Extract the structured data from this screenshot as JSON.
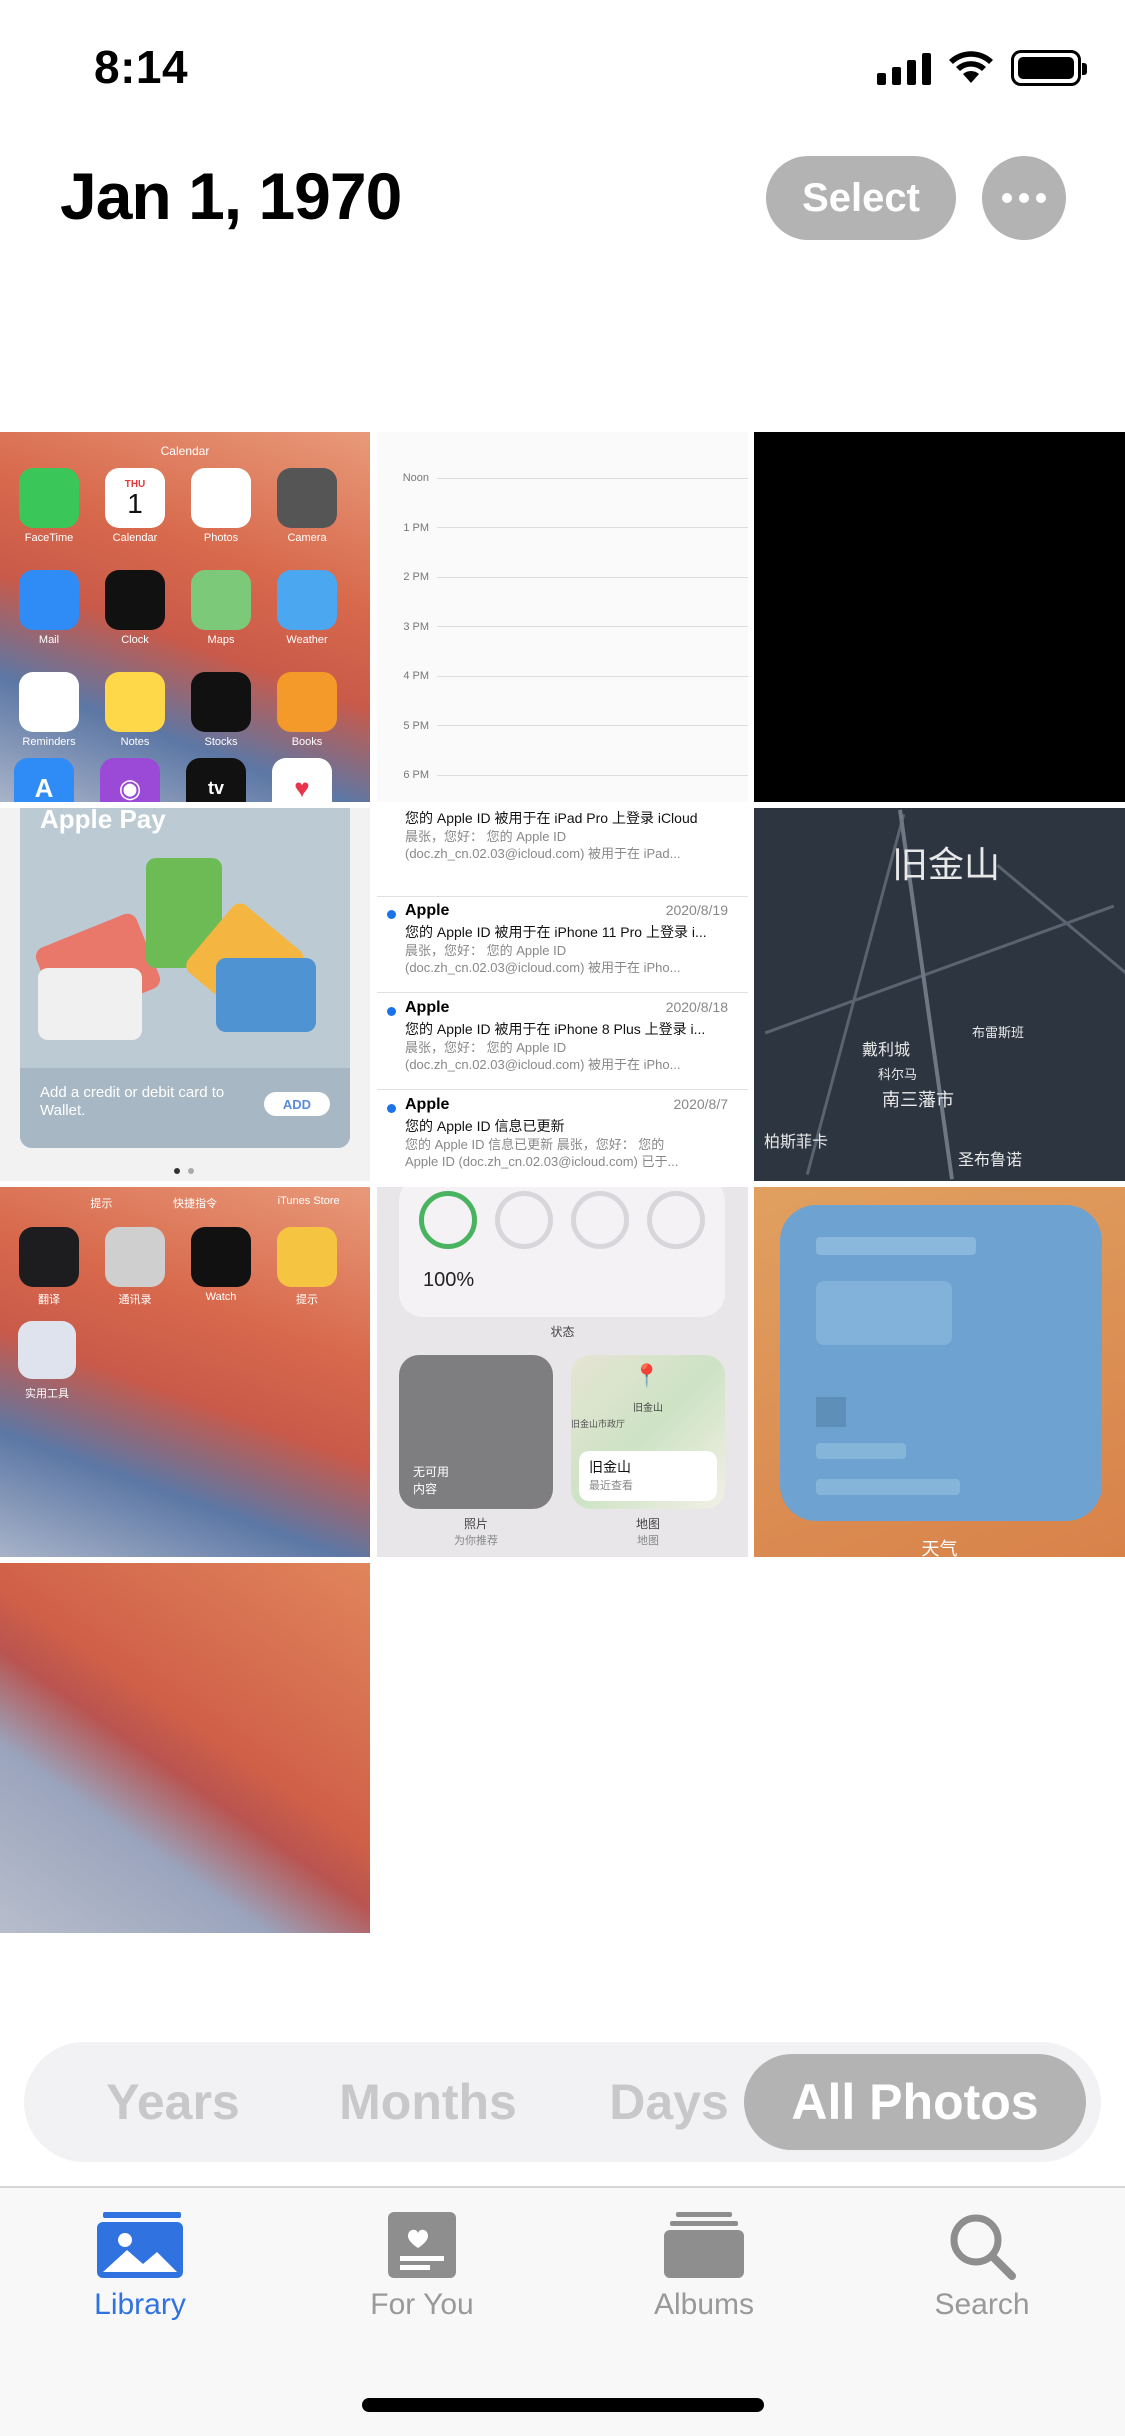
{
  "status_bar": {
    "time": "8:14"
  },
  "header": {
    "title": "Jan 1, 1970",
    "select_label": "Select"
  },
  "grid": {
    "home_screen": {
      "top_label": "Calendar",
      "calendar_day": "THU",
      "calendar_date": "1",
      "apps": [
        {
          "label": "FaceTime",
          "color": "#3bc65a"
        },
        {
          "label": "Calendar",
          "color": "#ffffff"
        },
        {
          "label": "Photos",
          "color": "#ffffff"
        },
        {
          "label": "Camera",
          "color": "#555555"
        },
        {
          "label": "Mail",
          "color": "#2f8bf5"
        },
        {
          "label": "Clock",
          "color": "#111111"
        },
        {
          "label": "Maps",
          "color": "#7cc97a"
        },
        {
          "label": "Weather",
          "color": "#4aa7f0"
        },
        {
          "label": "Reminders",
          "color": "#ffffff"
        },
        {
          "label": "Notes",
          "color": "#ffd84a"
        },
        {
          "label": "Stocks",
          "color": "#111111"
        },
        {
          "label": "Books",
          "color": "#f39a2a"
        }
      ],
      "tv_label": "tv"
    },
    "calendar_hours": [
      "Noon",
      "1 PM",
      "2 PM",
      "3 PM",
      "4 PM",
      "5 PM",
      "6 PM"
    ],
    "apple_pay": {
      "title": "Apple Pay",
      "footer_text": "Add a credit or debit card to Wallet.",
      "add_label": "ADD"
    },
    "mail": [
      {
        "from": "",
        "date": "",
        "subject": "您的 Apple ID 被用于在 iPad Pro 上登录 iCloud",
        "preview1": "晨张，您好： 您的 Apple ID",
        "preview2": "(doc.zh_cn.02.03@icloud.com) 被用于在 iPad..."
      },
      {
        "from": "Apple",
        "date": "2020/8/19",
        "subject": "您的 Apple ID 被用于在 iPhone 11 Pro 上登录 i...",
        "preview1": "晨张，您好： 您的 Apple ID",
        "preview2": "(doc.zh_cn.02.03@icloud.com) 被用于在 iPho..."
      },
      {
        "from": "Apple",
        "date": "2020/8/18",
        "subject": "您的 Apple ID 被用于在 iPhone 8 Plus 上登录 i...",
        "preview1": "晨张，您好： 您的 Apple ID",
        "preview2": "(doc.zh_cn.02.03@icloud.com) 被用于在 iPho..."
      },
      {
        "from": "Apple",
        "date": "2020/8/7",
        "subject": "您的 Apple ID 信息已更新",
        "preview1": "您的 Apple ID 信息已更新 晨张，您好： 您的",
        "preview2": "Apple ID (doc.zh_cn.02.03@icloud.com) 已于..."
      }
    ],
    "map": {
      "title": "旧金山",
      "labels": [
        "戴利城",
        "布雷斯班",
        "科尔马",
        "南三藩市",
        "柏斯菲卡",
        "圣布鲁诺"
      ]
    },
    "folder_screen": {
      "top_labels": [
        "提示",
        "快捷指令",
        "iTunes Store"
      ],
      "apps": [
        "翻译",
        "通讯录",
        "Watch",
        "提示"
      ],
      "folder_label": "实用工具"
    },
    "widgets": {
      "battery_pct": "100%",
      "status_label": "状态",
      "photos_text": "无可用\n内容",
      "photos_label": "照片",
      "photos_sub": "为你推荐",
      "map_place": "旧金山",
      "map_sub": "最近查看",
      "map_pin": "旧金山",
      "map_hall": "旧金山市政厅",
      "map_label": "地图",
      "map_sublabel": "地图"
    },
    "weather": {
      "label": "天气"
    }
  },
  "segmented": {
    "items": [
      "Years",
      "Months",
      "Days",
      "All Photos"
    ],
    "selected": "All Photos"
  },
  "tabbar": {
    "tabs": [
      "Library",
      "For You",
      "Albums",
      "Search"
    ],
    "active": "Library",
    "accent": "#2f72e0"
  }
}
